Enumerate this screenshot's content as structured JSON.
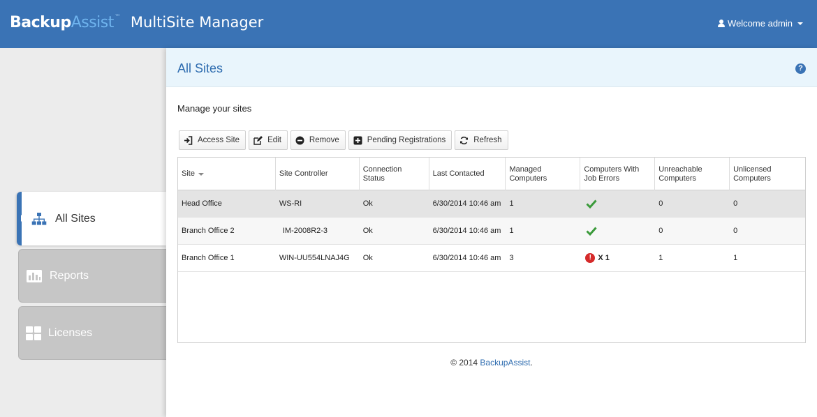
{
  "header": {
    "brand_backup": "Backup",
    "brand_assist": "Assist",
    "brand_tm": "™",
    "app_name": "MultiSite Manager",
    "user_menu": "Welcome admin",
    "colors": {
      "bar": "#3a73b5",
      "accent_text": "#6fb4ee"
    }
  },
  "sidebar": {
    "items": [
      {
        "label": "All Sites",
        "icon": "sitemap-icon",
        "active": true
      },
      {
        "label": "Reports",
        "icon": "bar-chart-icon",
        "active": false
      },
      {
        "label": "Licenses",
        "icon": "grid-icon",
        "active": false
      }
    ]
  },
  "page": {
    "title": "All Sites",
    "subtitle": "Manage your sites"
  },
  "toolbar": {
    "access_site": "Access Site",
    "edit": "Edit",
    "remove": "Remove",
    "pending": "Pending Registrations",
    "refresh": "Refresh"
  },
  "table": {
    "headers": [
      "Site",
      "Site Controller",
      "Connection Status",
      "Last Contacted",
      "Managed Computers",
      "Computers With Job Errors",
      "Unreachable Computers",
      "Unlicensed Computers"
    ],
    "rows": [
      {
        "site": "Head Office",
        "controller": "WS-RI",
        "status": "Ok",
        "last": "6/30/2014 10:46 am",
        "managed": "1",
        "errors": "",
        "error_state": "ok",
        "unreachable": "0",
        "unlicensed": "0"
      },
      {
        "site": "Branch Office 2",
        "controller": "IM-2008R2-3",
        "status": "Ok",
        "last": "6/30/2014 10:46 am",
        "managed": "1",
        "errors": "",
        "error_state": "ok",
        "unreachable": "0",
        "unlicensed": "0"
      },
      {
        "site": "Branch Office 1",
        "controller": "WIN-UU554LNAJ4G",
        "status": "Ok",
        "last": "6/30/2014 10:46 am",
        "managed": "3",
        "errors": "X 1",
        "error_state": "error",
        "unreachable": "1",
        "unlicensed": "1"
      }
    ]
  },
  "footer": {
    "prefix": "© 2014 ",
    "link": "BackupAssist",
    "suffix": "."
  }
}
